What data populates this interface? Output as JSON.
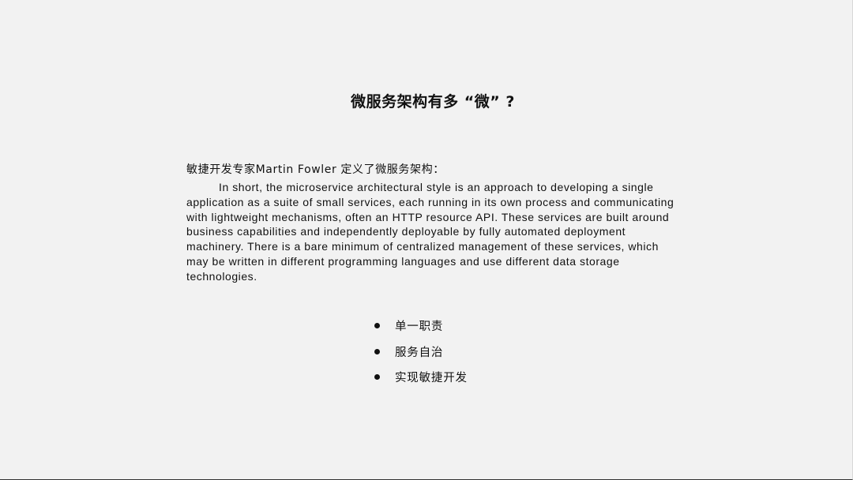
{
  "slide": {
    "title": "微服务架构有多 “微” ?",
    "intro": "敏捷开发专家Martin Fowler 定义了微服务架构：",
    "quote_lines": [
      "In short, the microservice architectural style is an approach to developing a single",
      "application as a suite of small services, each running in its own process and communicating",
      "with lightweight mechanisms, often an HTTP resource API. These services are built around",
      "business capabilities and independently deployable by fully automated deployment",
      "machinery. There is a bare minimum of centralized management of these services, which",
      "may be written in different programming languages and use different data storage",
      "technologies."
    ],
    "bullets": [
      "单一职责",
      "服务自治",
      "实现敏捷开发"
    ]
  }
}
